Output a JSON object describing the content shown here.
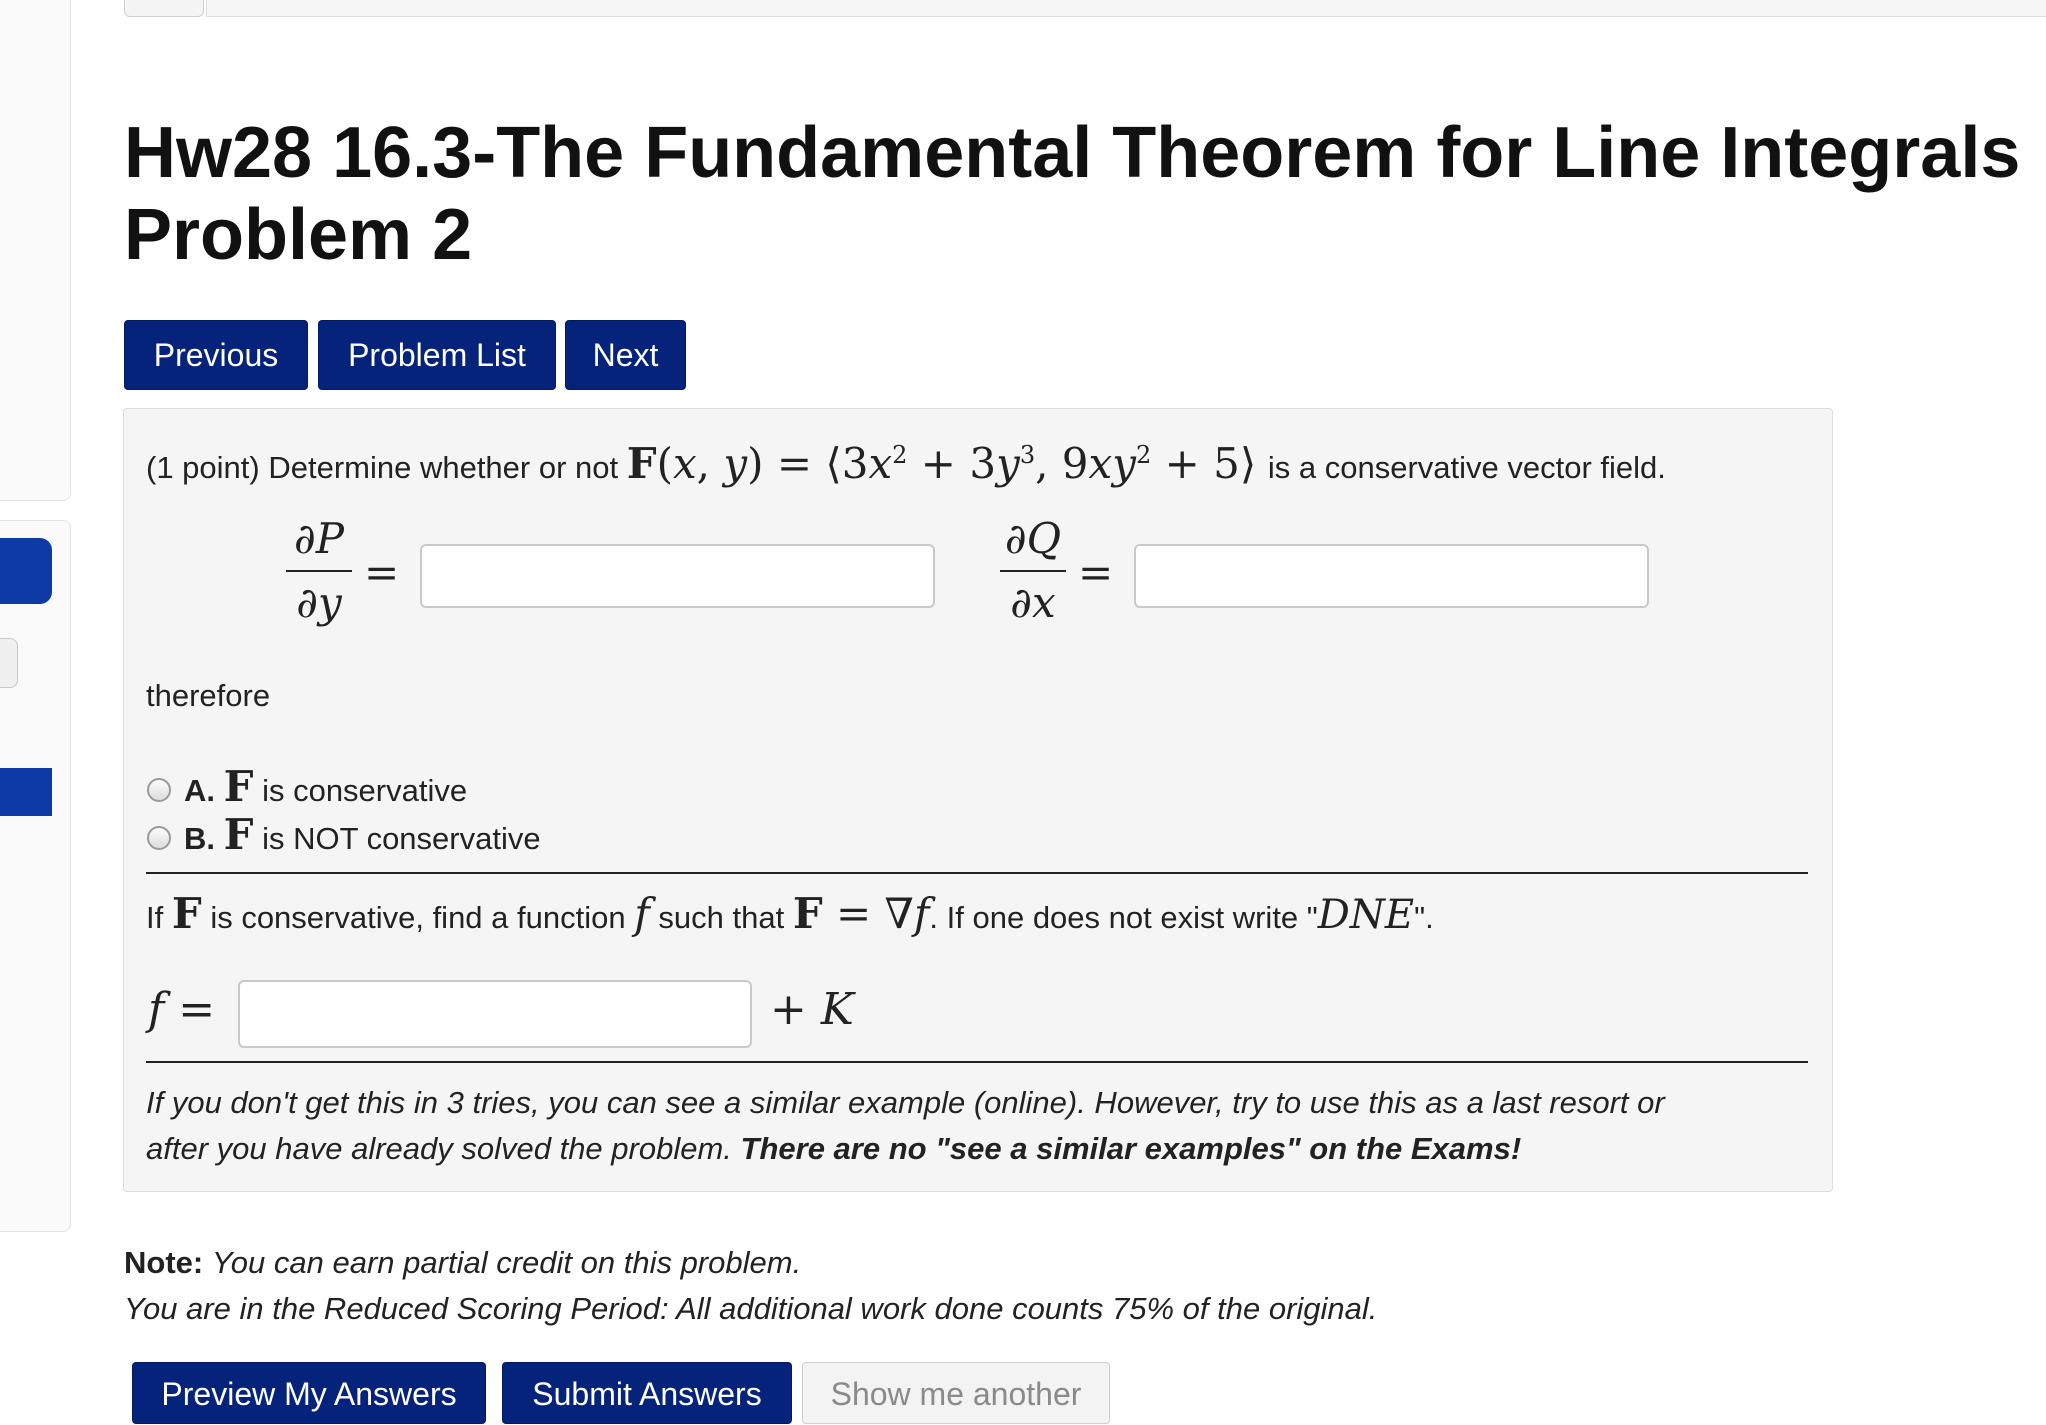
{
  "header": {
    "title_line1": "Hw28 16.3-The Fundamental Theorem for Line Integrals",
    "title_line2": "Problem 2"
  },
  "nav": {
    "previous": "Previous",
    "problem_list": "Problem List",
    "next": "Next"
  },
  "problem": {
    "intro_prefix": "(1 point) Determine whether or not",
    "intro_suffix": "is a conservative vector field.",
    "partials": {
      "p_num": "∂P",
      "p_den": "∂y",
      "q_num": "∂Q",
      "q_den": "∂x"
    },
    "therefore": "therefore",
    "options": [
      {
        "letter": "A.",
        "text": "is conservative"
      },
      {
        "letter": "B.",
        "text": "is NOT conservative"
      }
    ],
    "part2_prefix": "If",
    "part2_mid": "is conservative, find a function",
    "part2_mid2": "such that",
    "part2_suffix_a": ". If one does not exist write \"",
    "part2_suffix_b": "\".",
    "plus_k": "+ K",
    "hint_line1": "If you don't get this in 3 tries, you can see a similar example (online). However, try to use this as a last resort or",
    "hint_line2_plain": "after you have already solved the problem.",
    "hint_line2_bold": "There are no \"see a similar examples\" on the Exams!"
  },
  "notes": {
    "note_label": "Note:",
    "note_text": "You can earn partial credit on this problem.",
    "reduced": "You are in the Reduced Scoring Period: All additional work done counts 75% of the original."
  },
  "actions": {
    "preview": "Preview My Answers",
    "submit": "Submit Answers",
    "another": "Show me another"
  }
}
